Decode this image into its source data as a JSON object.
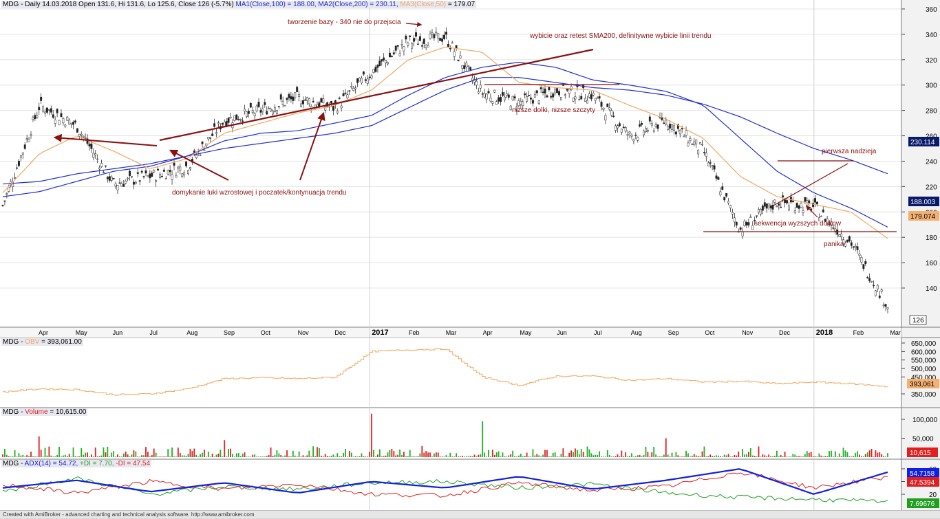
{
  "colors": {
    "price_ma1": "#1f2fd0",
    "price_ma2": "#1f2fd0",
    "price_ma3": "#f0a860",
    "annotation": "#8b1010",
    "obv": "#f0a860",
    "vol_up": "#20b020",
    "vol_down": "#e02020",
    "adx": "#1020e0",
    "plus_di": "#20a020",
    "minus_di": "#e02020"
  },
  "price_pane": {
    "title_main": "MDG - Daily 14.03.2018 Open 131.6, Hi 131.6, Lo 125.6, Close 126 (-5.7%) ",
    "title_ma1": "MA1(Close,100) = 188.00, ",
    "title_ma2": "MA2(Close,200) = 230.11, ",
    "title_ma3_name": "MA3(Close,50)",
    "title_ma3_val": " = 179.07",
    "y_ticks": [
      "360",
      "340",
      "320",
      "300",
      "280",
      "260",
      "240",
      "220",
      "200",
      "180",
      "160",
      "140"
    ],
    "badges": {
      "ma2": "230.114",
      "ma1": "188.003",
      "ma3": "179.074",
      "close": "126"
    },
    "x_labels": [
      "Apr",
      "May",
      "Jun",
      "Jul",
      "Aug",
      "Sep",
      "Oct",
      "Nov",
      "Dec",
      "2017",
      "Feb",
      "Mar",
      "Apr",
      "May",
      "Jun",
      "Jul",
      "Aug",
      "Sep",
      "Oct",
      "Nov",
      "Dec",
      "2018",
      "Feb",
      "Mar"
    ],
    "annotations": [
      "tworzenie bazy - 340 nie do przejscia",
      "wybicie oraz retest SMA200, definitywne wybicie linii trendu",
      "nizsze dolki, nizsze szczyty",
      "domykanie luki wzrostowej i poczatek/kontynuacja trendu",
      "pierwsza nadzieja",
      "sekwencja wyzszych dolkow",
      "panika"
    ]
  },
  "obv_pane": {
    "title_prefix": "MDG - ",
    "title_name": "OBV",
    "title_val": " = 393,061.00",
    "y_ticks": [
      "650,000",
      "600,000",
      "550,000",
      "500,000",
      "450,000",
      "350,000"
    ],
    "badge": "393,061"
  },
  "volume_pane": {
    "title_prefix": "MDG - ",
    "title_name": "Volume",
    "title_val": " = 10,615.00",
    "y_ticks": [
      "100,000",
      "50,000"
    ],
    "badge": "10,615"
  },
  "adx_pane": {
    "title_prefix": "MDG - ",
    "title_adx": "ADX(14) = 54.72, ",
    "title_pdi": "+DI = 7.70, ",
    "title_mdi": "-DI = 47.54",
    "y_ticks": [
      "60",
      "40",
      "20"
    ],
    "badges": {
      "adx": "54.7158",
      "mdi": "47.5394",
      "pdi": "7.69676"
    }
  },
  "footer": "Created with AmiBroker - advanced charting and technical analysis software. http://www.amibroker.com",
  "chart_data": [
    {
      "type": "line",
      "title": "MDG - Daily 14.03.2018",
      "note": "candlestick price chart with moving averages; values approximate",
      "x": [
        "2016-03",
        "2016-04",
        "2016-05",
        "2016-06",
        "2016-07",
        "2016-08",
        "2016-09",
        "2016-10",
        "2016-11",
        "2016-12",
        "2017-01",
        "2017-02",
        "2017-03",
        "2017-04",
        "2017-05",
        "2017-06",
        "2017-07",
        "2017-08",
        "2017-09",
        "2017-10",
        "2017-11",
        "2017-12",
        "2018-01",
        "2018-02",
        "2018-03"
      ],
      "ylim": [
        120,
        365
      ],
      "series": [
        {
          "name": "Close",
          "values": [
            205,
            284,
            268,
            222,
            228,
            236,
            272,
            280,
            290,
            282,
            310,
            334,
            338,
            294,
            286,
            296,
            292,
            260,
            272,
            248,
            186,
            208,
            204,
            176,
            126
          ]
        },
        {
          "name": "MA1(Close,100)",
          "values": [
            212,
            216,
            224,
            232,
            236,
            244,
            256,
            262,
            264,
            270,
            276,
            292,
            306,
            314,
            318,
            314,
            304,
            300,
            295,
            284,
            258,
            232,
            215,
            203,
            188
          ]
        },
        {
          "name": "MA2(Close,200)",
          "values": [
            222,
            224,
            230,
            234,
            238,
            244,
            250,
            254,
            258,
            262,
            268,
            282,
            296,
            306,
            306,
            302,
            298,
            296,
            292,
            285,
            275,
            262,
            250,
            241,
            230.11
          ]
        },
        {
          "name": "MA3(Close,50)",
          "values": [
            215,
            246,
            260,
            248,
            234,
            242,
            262,
            270,
            278,
            284,
            296,
            320,
            330,
            326,
            302,
            298,
            296,
            284,
            273,
            258,
            228,
            212,
            206,
            200,
            179.07
          ]
        }
      ]
    },
    {
      "type": "line",
      "title": "MDG - OBV = 393,061.00",
      "x": [
        "2016-03",
        "2016-04",
        "2016-05",
        "2016-06",
        "2016-07",
        "2016-08",
        "2016-09",
        "2016-10",
        "2016-11",
        "2016-12",
        "2017-01",
        "2017-02",
        "2017-03",
        "2017-04",
        "2017-05",
        "2017-06",
        "2017-07",
        "2017-08",
        "2017-09",
        "2017-10",
        "2017-11",
        "2017-12",
        "2018-01",
        "2018-02",
        "2018-03"
      ],
      "ylim": [
        330000,
        670000
      ],
      "series": [
        {
          "name": "OBV",
          "values": [
            362000,
            380000,
            375000,
            345000,
            350000,
            380000,
            440000,
            445000,
            440000,
            448000,
            600000,
            610000,
            615000,
            450000,
            400000,
            455000,
            455000,
            430000,
            440000,
            420000,
            425000,
            410000,
            420000,
            410000,
            393061
          ]
        }
      ]
    },
    {
      "type": "bar",
      "title": "MDG - Volume = 10,615.00",
      "x": [
        "2016-04",
        "2016-09",
        "2017-01",
        "2017-04",
        "2017-09",
        "2018-03"
      ],
      "ylim": [
        0,
        125000
      ],
      "series": [
        {
          "name": "Volume",
          "values": [
            55000,
            45000,
            115000,
            95000,
            50000,
            10615
          ]
        }
      ]
    },
    {
      "type": "line",
      "title": "MDG - ADX(14) = 54.72, +DI = 7.70, -DI = 47.54",
      "x": [
        "2016-03",
        "2016-05",
        "2016-07",
        "2016-09",
        "2016-11",
        "2017-01",
        "2017-03",
        "2017-05",
        "2017-07",
        "2017-09",
        "2017-11",
        "2018-01",
        "2018-03"
      ],
      "ylim": [
        5,
        68
      ],
      "series": [
        {
          "name": "ADX(14)",
          "values": [
            30,
            42,
            24,
            38,
            22,
            40,
            30,
            48,
            28,
            42,
            60,
            20,
            54.72
          ]
        },
        {
          "name": "+DI",
          "values": [
            25,
            45,
            20,
            32,
            28,
            38,
            40,
            30,
            36,
            22,
            15,
            12,
            7.7
          ]
        },
        {
          "name": "-DI",
          "values": [
            35,
            22,
            40,
            28,
            36,
            20,
            18,
            38,
            26,
            32,
            55,
            30,
            47.54
          ]
        }
      ]
    }
  ]
}
